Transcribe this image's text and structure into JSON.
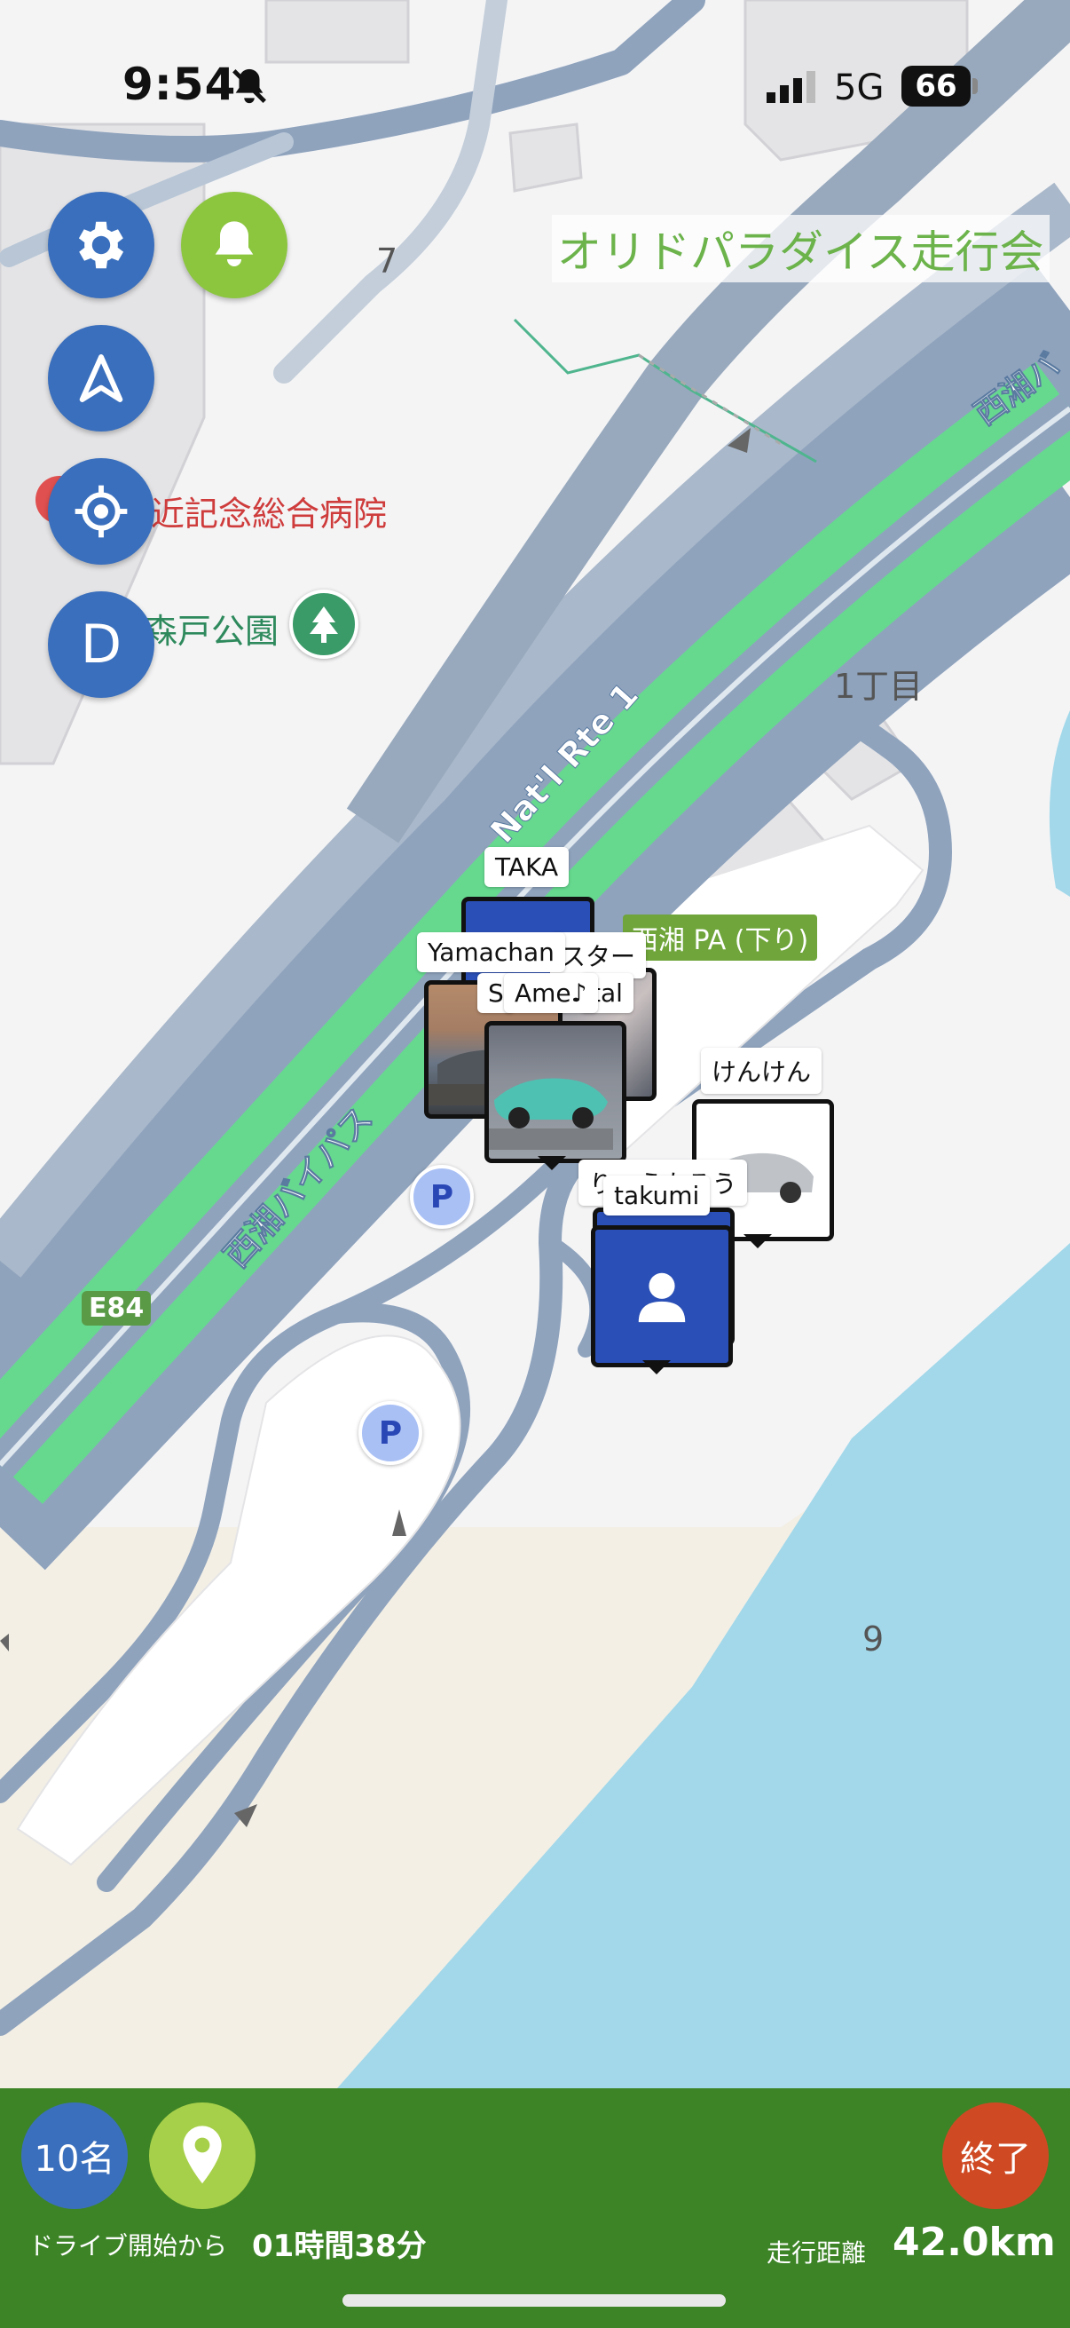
{
  "status_bar": {
    "time": "9:54",
    "network": "5G",
    "battery": "66"
  },
  "map_title": "オリドパラダイス走行会",
  "map_labels": {
    "hospital": "近記念総合病院",
    "park": "森戸公園",
    "area_number_7": "7",
    "chome": "1丁目",
    "area_number_9": "9",
    "national_route": "Nat'l Rte 1",
    "bypass_upper": "西湘バ",
    "bypass_lower": "西湘バイパス",
    "parking_area": "西湘 PA (下り)",
    "route_shield": "E84",
    "parking_symbol": "P"
  },
  "left_buttons": [
    {
      "name": "settings",
      "icon": "gear-icon"
    },
    {
      "name": "notifications",
      "icon": "bell-icon"
    },
    {
      "name": "navigation",
      "icon": "navigation-arrow-icon"
    },
    {
      "name": "locate",
      "icon": "crosshair-icon"
    },
    {
      "name": "d-mode",
      "label": "D"
    }
  ],
  "markers": {
    "taka": "TAKA",
    "yamachan": "Yamachan",
    "star": "スター",
    "s": "S",
    "ame": "Ame♪",
    "tal": "tal",
    "kenken": "けんけん",
    "ryotaro": "りょうたろう",
    "takumi": "takumi"
  },
  "bottom_bar": {
    "member_count": "10名",
    "location_icon": "map-pin-icon",
    "elapsed_label": "ドライブ開始から",
    "elapsed_value": "01時間38分",
    "distance_label": "走行距離",
    "distance_value": "42.0km",
    "end_label": "終了"
  },
  "colors": {
    "road_green": "#66d98f",
    "road_blue": "#8fa3bd",
    "sea": "#a2d8ea",
    "bar_green": "#3d8427",
    "button_blue": "#3a6fbd",
    "button_green": "#8cc63f",
    "end_red": "#cf4a23"
  }
}
